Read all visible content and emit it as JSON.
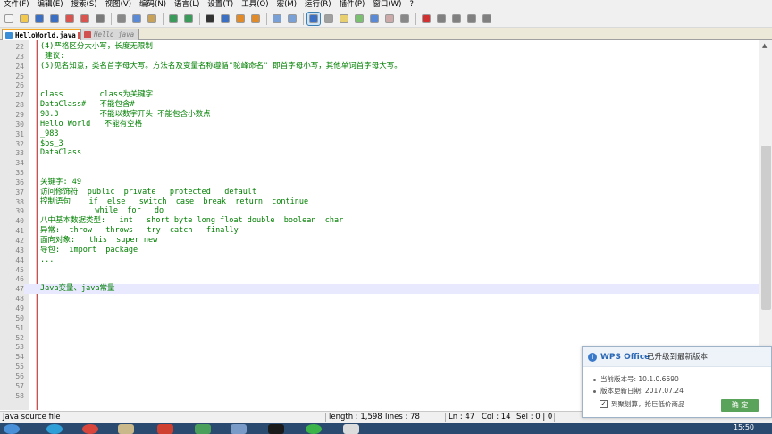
{
  "menu": [
    "文件(F)",
    "编辑(E)",
    "搜索(S)",
    "视图(V)",
    "编码(N)",
    "语言(L)",
    "设置(T)",
    "工具(O)",
    "宏(M)",
    "运行(R)",
    "插件(P)",
    "窗口(W)",
    "?"
  ],
  "toolbar": {
    "icons": [
      "new-file-icon",
      "open-file-icon",
      "save-icon",
      "save-all-icon",
      "close-icon",
      "close-all-icon",
      "print-icon",
      "cut-icon",
      "copy-icon",
      "paste-icon",
      "undo-icon",
      "redo-icon",
      "find-icon",
      "replace-icon",
      "zoom-in-icon",
      "zoom-out-icon",
      "sync-vertical-icon",
      "sync-horizontal-icon",
      "word-wrap-icon",
      "show-all-chars-icon",
      "indent-guide-icon",
      "document-map-icon",
      "function-list-icon",
      "folder-workspace-icon",
      "monitor-icon",
      "record-macro-icon",
      "stop-record-icon",
      "play-macro-icon",
      "run-macro-multiple-icon",
      "save-macro-icon"
    ]
  },
  "tabs": [
    {
      "label": "HelloWorld.java",
      "active": true
    },
    {
      "label": "Hello java",
      "active": false
    }
  ],
  "editor": {
    "current_line": 47,
    "lines": [
      {
        "n": "22",
        "text": "(4)严格区分大小写，长度无限制"
      },
      {
        "n": "23",
        "text": " 建议:"
      },
      {
        "n": "24",
        "text": "(5)见名知意，类名首字母大写。方法名及变量名称遵循\"驼峰命名\" 即首字母小写，其他单词首字母大写。"
      },
      {
        "n": "25",
        "text": ""
      },
      {
        "n": "26",
        "text": ""
      },
      {
        "n": "27",
        "text": "class        class为关键字"
      },
      {
        "n": "28",
        "text": "DataClass#   不能包含#"
      },
      {
        "n": "29",
        "text": "98.3         不能以数字开头 不能包含小数点"
      },
      {
        "n": "30",
        "text": "Hello World   不能有空格"
      },
      {
        "n": "31",
        "text": "_983"
      },
      {
        "n": "32",
        "text": "$bs_3"
      },
      {
        "n": "33",
        "text": "DataClass"
      },
      {
        "n": "34",
        "text": ""
      },
      {
        "n": "35",
        "text": ""
      },
      {
        "n": "36",
        "text": "关键字: 49"
      },
      {
        "n": "37",
        "text": "访问修饰符  public  private   protected   default"
      },
      {
        "n": "38",
        "text": "控制语句    if  else   switch  case  break  return  continue"
      },
      {
        "n": "39",
        "text": "            while  for   do"
      },
      {
        "n": "40",
        "text": "八中基本数据类型:   int   short byte long float double  boolean  char"
      },
      {
        "n": "41",
        "text": "异常:  throw   throws   try  catch   finally"
      },
      {
        "n": "42",
        "text": "面向对象:   this  super new"
      },
      {
        "n": "43",
        "text": "导包:  import  package"
      },
      {
        "n": "44",
        "text": "..."
      },
      {
        "n": "45",
        "text": ""
      },
      {
        "n": "46",
        "text": ""
      },
      {
        "n": "47",
        "text": "Java变量、java常量"
      },
      {
        "n": "48",
        "text": ""
      },
      {
        "n": "49",
        "text": ""
      },
      {
        "n": "50",
        "text": ""
      },
      {
        "n": "51",
        "text": ""
      },
      {
        "n": "52",
        "text": ""
      },
      {
        "n": "53",
        "text": ""
      },
      {
        "n": "54",
        "text": ""
      },
      {
        "n": "55",
        "text": ""
      },
      {
        "n": "56",
        "text": ""
      },
      {
        "n": "57",
        "text": ""
      },
      {
        "n": "58",
        "text": ""
      }
    ]
  },
  "status": {
    "file_type": "Java source file",
    "length": "length : 1,598",
    "lines": "lines : 78",
    "ln": "Ln : 47",
    "col": "Col : 14",
    "sel": "Sel : 0 | 0"
  },
  "taskbar": {
    "clock": "15:50"
  },
  "wps_popup": {
    "brand": "WPS Office",
    "title": "已升级到最新版本",
    "version": "当前版本号: 10.1.0.6690",
    "update_date": "版本更新日期: 2017.07.24",
    "checkbox_label": "到聚划算，抢巨低价商品",
    "checkbox_checked": true,
    "ok_button": "确 定"
  },
  "colors": {
    "code_text": "#008000",
    "edge_line": "#e04848",
    "current_line": "#e8e8ff",
    "active_tab_accent": "#f5a623",
    "wps_ok": "#5aa35a",
    "taskbar": "#2b4a6f"
  }
}
